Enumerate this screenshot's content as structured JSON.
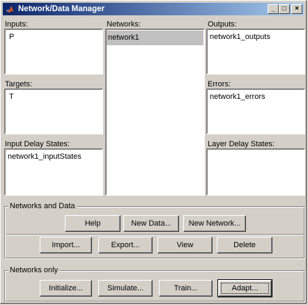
{
  "window": {
    "title": "Network/Data Manager"
  },
  "panels": {
    "inputs": {
      "label": "Inputs:",
      "items": [
        "P"
      ]
    },
    "networks": {
      "label": "Networks:",
      "items": [
        "network1"
      ]
    },
    "outputs": {
      "label": "Outputs:",
      "items": [
        "network1_outputs"
      ]
    },
    "targets": {
      "label": "Targets:",
      "items": [
        "T"
      ]
    },
    "errors": {
      "label": "Errors:",
      "items": [
        "network1_errors"
      ]
    },
    "input_delay_states": {
      "label": "Input Delay States:",
      "items": [
        "network1_inputStates"
      ]
    },
    "layer_delay_states": {
      "label": "Layer Delay States:",
      "items": []
    }
  },
  "networks_and_data": {
    "title": "Networks and Data",
    "help": "Help",
    "new_data": "New Data...",
    "new_network": "New Network...",
    "import": "Import...",
    "export": "Export...",
    "view": "View",
    "delete": "Delete"
  },
  "networks_only": {
    "title": "Networks only",
    "initialize": "Initialize...",
    "simulate": "Simulate...",
    "train": "Train...",
    "adapt": "Adapt..."
  },
  "colors": {
    "title_start": "#0a246a",
    "title_end": "#a6caf0",
    "face": "#d4d0c8",
    "selection": "#c0c0c0"
  },
  "icons": {
    "app": "matlab-logo-icon",
    "minimize": "minimize-icon",
    "maximize": "maximize-icon",
    "close": "close-icon"
  }
}
